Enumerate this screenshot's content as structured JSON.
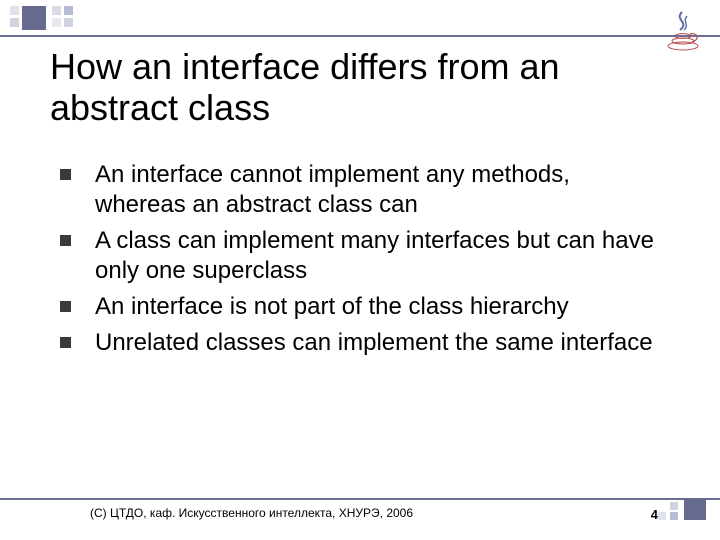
{
  "title": "How an interface differs from an abstract class",
  "bullets": [
    "An interface cannot implement any methods, whereas an abstract class can",
    "A class can implement many interfaces but can have only one superclass",
    "An interface is not part of the class hierarchy",
    "Unrelated classes can implement the same interface"
  ],
  "footer": {
    "copyright": "(С) ЦТДО, каф. Искусственного интеллекта, ХНУРЭ, 2006",
    "page": "4"
  }
}
